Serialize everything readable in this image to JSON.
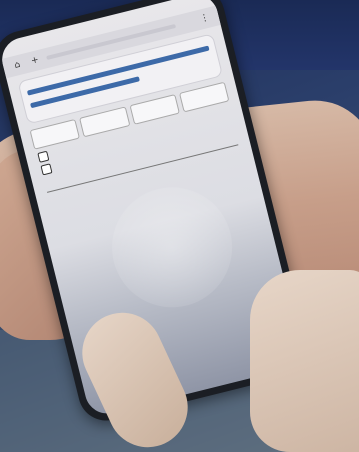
{
  "phone": {
    "status": {
      "time": "",
      "battery": ""
    },
    "browser": {
      "url": "",
      "tab_count": ""
    },
    "card": {
      "title": "",
      "subtitle": "",
      "question": "",
      "code": "",
      "price_left": "",
      "price_right": ""
    },
    "quantity": {
      "label": "",
      "options": [
        "",
        "",
        "",
        ""
      ]
    },
    "options_title": "",
    "options": [
      {
        "label": ""
      },
      {
        "label": ""
      }
    ],
    "field_label": ""
  }
}
